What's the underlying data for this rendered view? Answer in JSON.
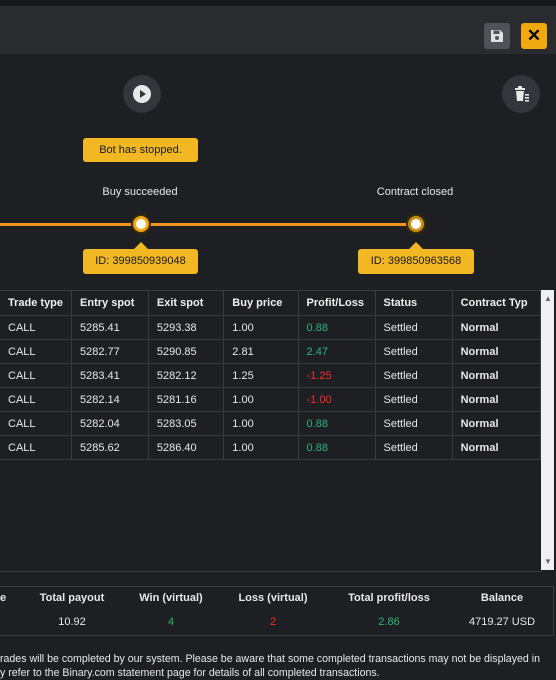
{
  "run_panel": {
    "status_tooltip": "Bot has stopped.",
    "steps": [
      {
        "label": "Buy succeeded",
        "id_tooltip": "ID: 399850939048"
      },
      {
        "label": "Contract closed",
        "id_tooltip": "ID: 399850963568"
      }
    ]
  },
  "transactions": {
    "columns": [
      "Trade type",
      "Entry spot",
      "Exit spot",
      "Buy price",
      "Profit/Loss",
      "Status",
      "Contract Typ"
    ],
    "rows": [
      [
        "CALL",
        "5285.41",
        "5293.38",
        "1.00",
        "0.88",
        "Settled",
        "Normal"
      ],
      [
        "CALL",
        "5282.77",
        "5290.85",
        "2.81",
        "2.47",
        "Settled",
        "Normal"
      ],
      [
        "CALL",
        "5283.41",
        "5282.12",
        "1.25",
        "-1.25",
        "Settled",
        "Normal"
      ],
      [
        "CALL",
        "5282.14",
        "5281.16",
        "1.00",
        "-1.00",
        "Settled",
        "Normal"
      ],
      [
        "CALL",
        "5282.04",
        "5283.05",
        "1.00",
        "0.88",
        "Settled",
        "Normal"
      ],
      [
        "CALL",
        "5285.62",
        "5286.40",
        "1.00",
        "0.88",
        "Settled",
        "Normal"
      ]
    ]
  },
  "summary": {
    "headers": [
      "e",
      "Total payout",
      "Win (virtual)",
      "Loss (virtual)",
      "Total profit/loss",
      "Balance"
    ],
    "values": [
      "",
      "10.92",
      "4",
      "2",
      "2.86",
      "4719.27 USD"
    ]
  },
  "footer": {
    "line1": "rades will be completed by our system. Please be aware that some completed transactions may not be displayed in",
    "line2": "y refer to the Binary.com statement page for details of all completed transactions."
  },
  "colors": {
    "accent": "#f2a90f",
    "profit": "#2bb673",
    "loss": "#ff2b2b"
  }
}
